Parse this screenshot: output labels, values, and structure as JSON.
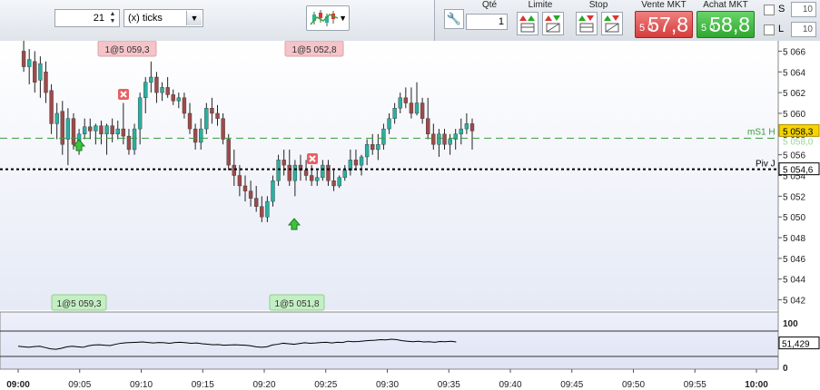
{
  "toolbar": {
    "tick_count": "21",
    "unit": "(x) ticks",
    "chart_type_icon": "candlestick-chart-icon"
  },
  "order": {
    "qty_label": "Qté",
    "qty_value": "1",
    "limit_label": "Limite",
    "stop_label": "Stop",
    "sell_label": "Vente MKT",
    "sell_prefix": "5 0",
    "sell_price": "57,8",
    "buy_label": "Achat MKT",
    "buy_prefix": "5 0",
    "buy_price": "58,8",
    "s_label": "S",
    "s_value": "10",
    "l_label": "L",
    "l_value": "10"
  },
  "chart": {
    "price_ticks": [
      "5 066",
      "5 064",
      "5 062",
      "5 060",
      "5 058",
      "5 056",
      "5 054",
      "5 052",
      "5 050",
      "5 048",
      "5 046",
      "5 044",
      "5 042"
    ],
    "current_price": "5 058,3",
    "pivot_price": "5 054,6",
    "pivot_label": "Piv J",
    "ms1_label": "mS1 H",
    "overlap_label": "5 058,0",
    "time_ticks": [
      "09:00",
      "09:05",
      "09:10",
      "09:15",
      "09:20",
      "09:25",
      "09:30",
      "09:35",
      "09:40",
      "09:45",
      "09:50",
      "09:55",
      "10:00"
    ],
    "sell_tags": [
      "1@5 059,3",
      "1@5 052,8"
    ],
    "buy_tags": [
      "1@5 059,3",
      "1@5 051,8"
    ],
    "osc_ticks": [
      "100",
      "0"
    ],
    "osc_value": "51,429",
    "colors": {
      "up": "#2ab0a0",
      "down": "#9e4a4a",
      "pivot": "#000000",
      "ms1": "#3a9a3a",
      "sell_tag": "#f4c4c8",
      "buy_tag": "#c4eec4",
      "price_box": "#f5d400"
    }
  },
  "chart_data": {
    "type": "candlestick",
    "candles": [
      [
        5066.0,
        5067.0,
        5064.0,
        5064.5
      ],
      [
        5064.5,
        5066.2,
        5062.8,
        5065.2
      ],
      [
        5065.0,
        5066.0,
        5062.0,
        5063.0
      ],
      [
        5063.2,
        5065.5,
        5061.5,
        5064.8
      ],
      [
        5064.0,
        5065.0,
        5061.0,
        5062.0
      ],
      [
        5062.2,
        5062.8,
        5058.0,
        5059.0
      ],
      [
        5059.0,
        5061.0,
        5057.5,
        5060.0
      ],
      [
        5060.2,
        5061.2,
        5056.0,
        5057.0
      ],
      [
        5057.5,
        5060.5,
        5055.0,
        5059.5
      ],
      [
        5059.5,
        5060.0,
        5056.5,
        5057.0
      ],
      [
        5057.0,
        5058.5,
        5056.0,
        5058.0
      ],
      [
        5058.0,
        5059.5,
        5057.5,
        5058.7
      ],
      [
        5058.7,
        5059.5,
        5057.5,
        5058.3
      ],
      [
        5058.3,
        5059.0,
        5057.0,
        5058.8
      ],
      [
        5058.8,
        5059.3,
        5057.0,
        5058.0
      ],
      [
        5058.0,
        5059.0,
        5056.0,
        5058.8
      ],
      [
        5058.8,
        5059.5,
        5057.2,
        5058.0
      ],
      [
        5058.0,
        5059.3,
        5057.5,
        5058.5
      ],
      [
        5058.5,
        5061.0,
        5057.0,
        5057.8
      ],
      [
        5057.8,
        5058.5,
        5056.0,
        5056.5
      ],
      [
        5056.5,
        5059.0,
        5056.0,
        5058.5
      ],
      [
        5058.5,
        5062.0,
        5057.0,
        5061.5
      ],
      [
        5061.5,
        5063.5,
        5060.0,
        5063.0
      ],
      [
        5063.0,
        5065.0,
        5062.0,
        5063.5
      ],
      [
        5063.5,
        5064.0,
        5061.0,
        5062.0
      ],
      [
        5062.0,
        5063.0,
        5061.2,
        5062.5
      ],
      [
        5062.5,
        5063.5,
        5061.5,
        5061.8
      ],
      [
        5061.8,
        5062.3,
        5060.8,
        5061.2
      ],
      [
        5061.2,
        5062.0,
        5060.5,
        5061.5
      ],
      [
        5061.5,
        5062.0,
        5059.5,
        5060.0
      ],
      [
        5060.0,
        5061.0,
        5058.0,
        5058.5
      ],
      [
        5058.5,
        5059.0,
        5056.5,
        5057.2
      ],
      [
        5057.2,
        5059.5,
        5056.5,
        5058.5
      ],
      [
        5058.5,
        5061.0,
        5058.0,
        5060.5
      ],
      [
        5060.5,
        5061.5,
        5059.0,
        5060.0
      ],
      [
        5060.0,
        5060.8,
        5058.8,
        5059.5
      ],
      [
        5059.5,
        5060.0,
        5057.0,
        5057.5
      ],
      [
        5057.5,
        5058.0,
        5054.5,
        5055.0
      ],
      [
        5055.0,
        5056.5,
        5053.0,
        5054.0
      ],
      [
        5054.0,
        5055.0,
        5052.0,
        5053.0
      ],
      [
        5053.0,
        5054.0,
        5051.5,
        5052.5
      ],
      [
        5052.5,
        5053.5,
        5051.0,
        5051.8
      ],
      [
        5051.8,
        5053.0,
        5050.5,
        5051.0
      ],
      [
        5051.0,
        5052.0,
        5049.5,
        5050.0
      ],
      [
        5050.0,
        5052.0,
        5049.5,
        5051.5
      ],
      [
        5051.5,
        5054.0,
        5051.0,
        5053.5
      ],
      [
        5053.5,
        5056.0,
        5053.0,
        5055.5
      ],
      [
        5055.5,
        5056.5,
        5054.0,
        5055.0
      ],
      [
        5055.0,
        5056.5,
        5053.0,
        5053.5
      ],
      [
        5053.5,
        5055.5,
        5052.0,
        5055.0
      ],
      [
        5055.0,
        5056.0,
        5053.5,
        5054.5
      ],
      [
        5054.5,
        5055.5,
        5053.5,
        5054.0
      ],
      [
        5054.0,
        5055.0,
        5053.0,
        5053.5
      ],
      [
        5053.5,
        5054.5,
        5053.0,
        5053.8
      ],
      [
        5053.8,
        5055.5,
        5053.5,
        5055.0
      ],
      [
        5055.0,
        5055.5,
        5053.0,
        5053.5
      ],
      [
        5053.5,
        5054.5,
        5052.5,
        5053.0
      ],
      [
        5053.0,
        5054.0,
        5052.8,
        5053.8
      ],
      [
        5053.8,
        5055.0,
        5053.5,
        5054.5
      ],
      [
        5054.5,
        5056.5,
        5054.0,
        5055.5
      ],
      [
        5055.5,
        5056.5,
        5054.5,
        5055.0
      ],
      [
        5055.0,
        5056.0,
        5054.0,
        5055.8
      ],
      [
        5055.8,
        5057.5,
        5055.0,
        5057.0
      ],
      [
        5057.0,
        5058.0,
        5056.0,
        5056.5
      ],
      [
        5056.5,
        5058.0,
        5055.5,
        5057.0
      ],
      [
        5057.0,
        5059.0,
        5056.5,
        5058.5
      ],
      [
        5058.5,
        5060.0,
        5058.0,
        5059.5
      ],
      [
        5059.5,
        5061.0,
        5059.0,
        5060.5
      ],
      [
        5060.5,
        5062.0,
        5060.0,
        5061.5
      ],
      [
        5061.5,
        5062.5,
        5060.5,
        5061.0
      ],
      [
        5061.0,
        5062.5,
        5059.5,
        5060.0
      ],
      [
        5060.0,
        5063.0,
        5059.8,
        5061.0
      ],
      [
        5061.0,
        5061.5,
        5059.0,
        5059.5
      ],
      [
        5059.5,
        5061.5,
        5057.5,
        5058.0
      ],
      [
        5058.0,
        5059.0,
        5056.5,
        5057.0
      ],
      [
        5057.0,
        5058.5,
        5055.8,
        5058.0
      ],
      [
        5058.0,
        5058.5,
        5056.5,
        5057.0
      ],
      [
        5057.0,
        5058.0,
        5056.0,
        5057.5
      ],
      [
        5057.5,
        5058.5,
        5056.5,
        5058.0
      ],
      [
        5058.0,
        5059.5,
        5057.0,
        5058.5
      ],
      [
        5058.5,
        5060.0,
        5058.0,
        5059.0
      ],
      [
        5059.0,
        5059.5,
        5056.5,
        5058.3
      ]
    ],
    "x_start": "09:00",
    "candle_minutes": 0.45,
    "ylim": [
      5041,
      5067
    ],
    "pivot": 5054.6,
    "ms1": 5057.6,
    "oscillator": [
      40,
      38,
      36,
      39,
      40,
      35,
      30,
      28,
      32,
      38,
      40,
      38,
      36,
      42,
      45,
      46,
      44,
      43,
      48,
      52,
      54,
      55,
      56,
      57,
      55,
      53,
      55,
      54,
      52,
      55,
      56,
      54,
      52,
      53,
      50,
      48,
      46,
      47,
      44,
      45,
      46,
      45,
      44,
      42,
      38,
      36,
      38,
      45,
      48,
      52,
      50,
      48,
      51,
      54,
      52,
      53,
      55,
      56,
      53,
      56,
      55,
      60,
      58,
      59,
      61,
      63,
      64,
      66,
      65,
      68,
      66,
      62,
      60,
      58,
      60,
      57,
      58,
      56,
      59,
      58,
      60,
      57
    ],
    "osc_ylim": [
      0,
      100
    ]
  }
}
